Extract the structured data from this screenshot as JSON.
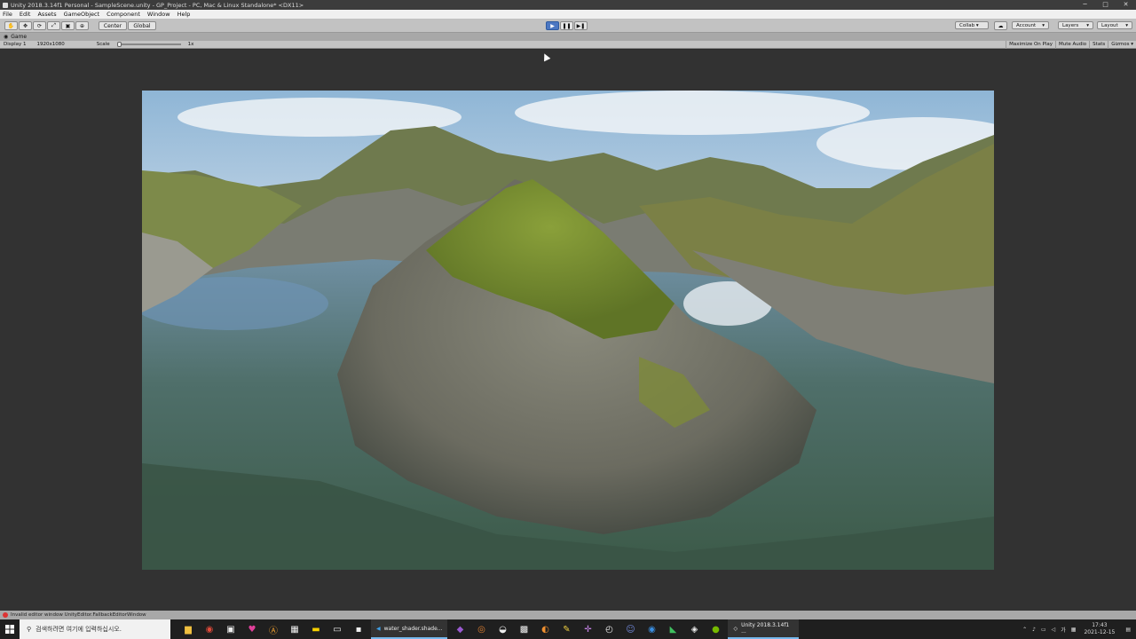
{
  "window": {
    "title": "Unity 2018.3.14f1 Personal - SampleScene.unity - GP_Project - PC, Mac & Linux Standalone* <DX11>",
    "minimize": "─",
    "maximize": "□",
    "close": "✕"
  },
  "menu": [
    "File",
    "Edit",
    "Assets",
    "GameObject",
    "Component",
    "Window",
    "Help"
  ],
  "toolbar": {
    "pivot": "Center",
    "space": "Global",
    "collab": "Collab ▾",
    "account": "Account",
    "layers": "Layers",
    "layout": "Layout"
  },
  "game_tab": {
    "label": "Game"
  },
  "game_bar": {
    "display": "Display 1",
    "resolution": "1920x1080",
    "scale_label": "Scale",
    "scale_value": "1x",
    "maximize_on_play": "Maximize On Play",
    "mute_audio": "Mute Audio",
    "stats": "Stats",
    "gizmos": "Gizmos ▾"
  },
  "status": {
    "message": "Invalid editor window UnityEditor.FallbackEditorWindow"
  },
  "taskbar": {
    "search_placeholder": "검색하려면 여기에 입력하십시오.",
    "app1": "water_shader.shade...",
    "app2": "Unity 2018.3.14f1 ...",
    "time": "17:43",
    "date": "2021-12-15"
  },
  "icons": [
    "unity-icon",
    "hand-tool-icon",
    "move-tool-icon",
    "rotate-tool-icon",
    "scale-tool-icon",
    "rect-tool-icon",
    "transform-tool-icon",
    "play-icon",
    "pause-icon",
    "step-icon",
    "cloud-icon",
    "windows-start-icon",
    "search-icon"
  ]
}
